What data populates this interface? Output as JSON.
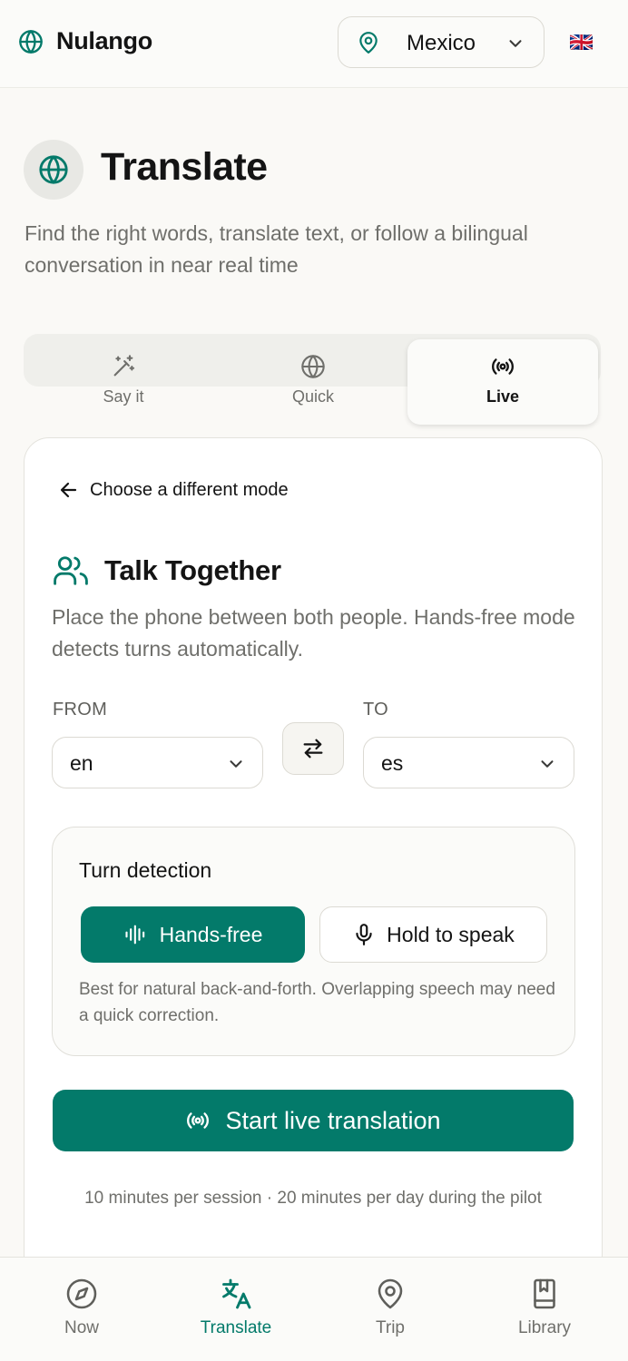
{
  "colors": {
    "accent": "#037a6a",
    "text_primary": "#141414",
    "text_muted": "#6f6f6b",
    "background": "#faf9f6"
  },
  "header": {
    "brand_icon": "globe-icon",
    "app_name": "Nulango",
    "country_icon": "map-pin-icon",
    "country": "Mexico",
    "language_flag": "🇬🇧"
  },
  "page": {
    "icon": "globe-icon",
    "title": "Translate",
    "subtitle": "Find the right words, translate text, or follow a bilingual conversation in near real time"
  },
  "mode_tabs": {
    "active": "Live",
    "items": [
      {
        "label": "Say it",
        "icon": "magic-wand-icon"
      },
      {
        "label": "Quick",
        "icon": "globe-icon"
      },
      {
        "label": "Live",
        "icon": "broadcast-icon"
      }
    ]
  },
  "live": {
    "back_label": "Choose a different mode",
    "section_icon": "users-icon",
    "section_title": "Talk Together",
    "section_description": "Place the phone between both people. Hands-free mode detects turns automatically.",
    "from_label": "FROM",
    "from_value": "en",
    "to_label": "TO",
    "to_value": "es",
    "swap_icon": "swap-arrows-icon",
    "turn_detection": {
      "title": "Turn detection",
      "selected": "Hands-free",
      "options": [
        {
          "label": "Hands-free",
          "icon": "audio-wave-icon"
        },
        {
          "label": "Hold to speak",
          "icon": "microphone-icon"
        }
      ],
      "help": "Best for natural back-and-forth. Overlapping speech may need a quick correction."
    },
    "start_label": "Start live translation",
    "quota_note": "10 minutes per session · 20 minutes per day during the pilot"
  },
  "bottom_nav": {
    "active": "Translate",
    "items": [
      {
        "label": "Now",
        "icon": "compass-icon"
      },
      {
        "label": "Translate",
        "icon": "translate-icon"
      },
      {
        "label": "Trip",
        "icon": "map-pin-icon"
      },
      {
        "label": "Library",
        "icon": "book-icon"
      }
    ]
  }
}
